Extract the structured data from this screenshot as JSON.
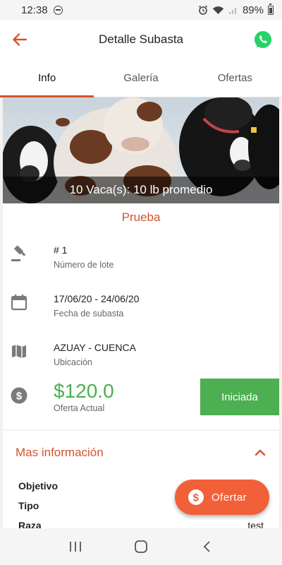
{
  "status_bar": {
    "time": "12:38",
    "battery": "89%"
  },
  "app_bar": {
    "title": "Detalle Subasta"
  },
  "tabs": [
    {
      "label": "Info",
      "active": true
    },
    {
      "label": "Galería",
      "active": false
    },
    {
      "label": "Ofertas",
      "active": false
    }
  ],
  "hero": {
    "caption": "10 Vaca(s): 10 lb promedio"
  },
  "lot": {
    "name": "Prueba"
  },
  "details": {
    "lot_number": {
      "value": "# 1",
      "label": "Número de lote",
      "icon": "gavel-icon"
    },
    "dates": {
      "value": "17/06/20 - 24/06/20",
      "label": "Fecha de subasta",
      "icon": "calendar-icon"
    },
    "location": {
      "value": "AZUAY - CUENCA",
      "label": "Ubicación",
      "icon": "map-icon"
    },
    "price": {
      "value": "$120.0",
      "label": "Oferta Actual",
      "icon": "dollar-icon"
    }
  },
  "status_button": {
    "label": "Iniciada"
  },
  "more_info": {
    "title": "Mas información",
    "rows": [
      {
        "label": "Objetivo",
        "value": ""
      },
      {
        "label": "Tipo",
        "value": ""
      },
      {
        "label": "Raza",
        "value": "test"
      }
    ]
  },
  "fab": {
    "label": "Ofertar"
  },
  "colors": {
    "accent": "#d4542e",
    "fab": "#f2603a",
    "green": "#4caf50",
    "whatsapp": "#25d366"
  }
}
